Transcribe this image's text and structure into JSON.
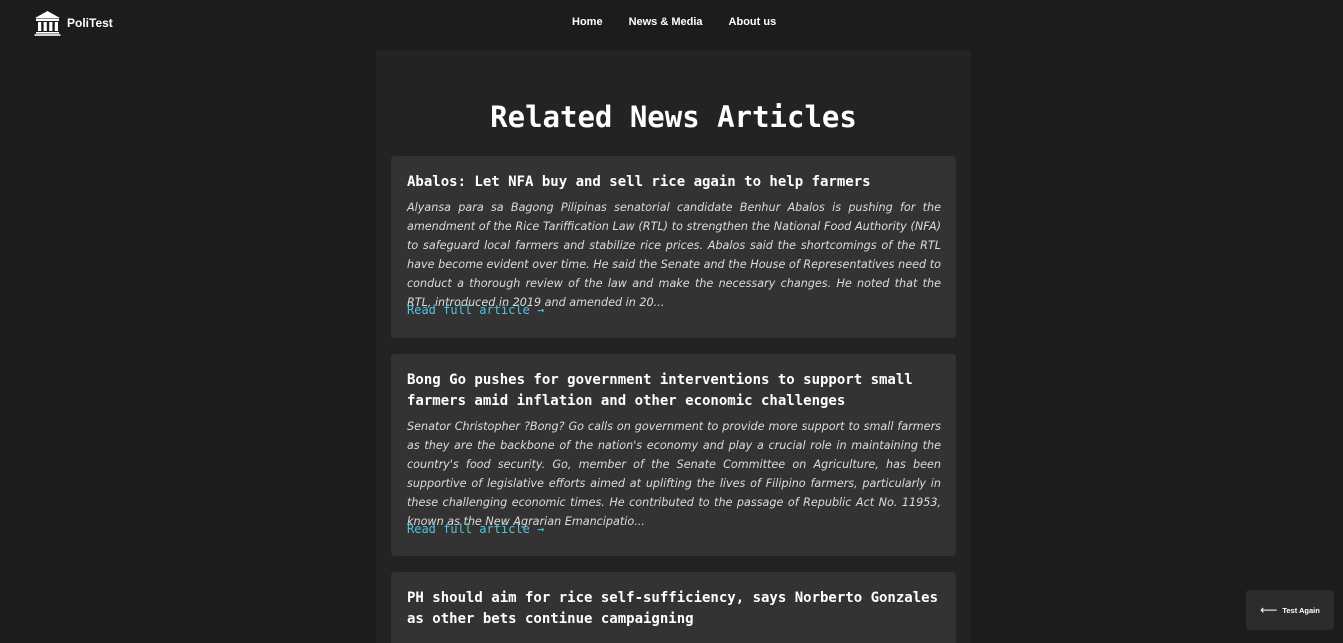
{
  "brand": {
    "name": "PoliTest",
    "icon": "institution-icon"
  },
  "nav": {
    "links": [
      {
        "label": "Home"
      },
      {
        "label": "News & Media"
      },
      {
        "label": "About us"
      }
    ]
  },
  "main": {
    "title": "Related News Articles",
    "articles": [
      {
        "title": "Abalos: Let NFA buy and sell rice again to help farmers",
        "description": "Alyansa para sa Bagong Pilipinas senatorial candidate Benhur Abalos is pushing for the amendment of the Rice Tariffication Law (RTL) to strengthen the National Food Authority (NFA) to safeguard local farmers and stabilize rice prices. Abalos said the shortcomings of the RTL have become evident over time. He said the Senate and the House of Representatives need to conduct a thorough review of the law and make the necessary changes. He noted that the RTL, introduced in 2019 and amended in 20...",
        "link_label": "Read full article →"
      },
      {
        "title": "Bong Go pushes for government interventions to support small farmers amid inflation and other economic challenges",
        "description": "Senator Christopher ?Bong? Go calls on government to provide more support to small farmers as they are the backbone of the nation's economy and play a crucial role in maintaining the country's food security. Go, member of the Senate Committee on Agriculture, has been supportive of legislative efforts aimed at uplifting the lives of Filipino farmers, particularly in these challenging economic times. He contributed to the passage of Republic Act No. 11953, known as the New Agrarian Emancipatio...",
        "link_label": "Read full article →"
      },
      {
        "title": "PH should aim for rice self-sufficiency, says Norberto Gonzales as other bets continue campaigning",
        "description": "",
        "link_label": ""
      }
    ]
  },
  "floating": {
    "test_again_label": "Test Again",
    "icon": "arrow-left-icon"
  }
}
